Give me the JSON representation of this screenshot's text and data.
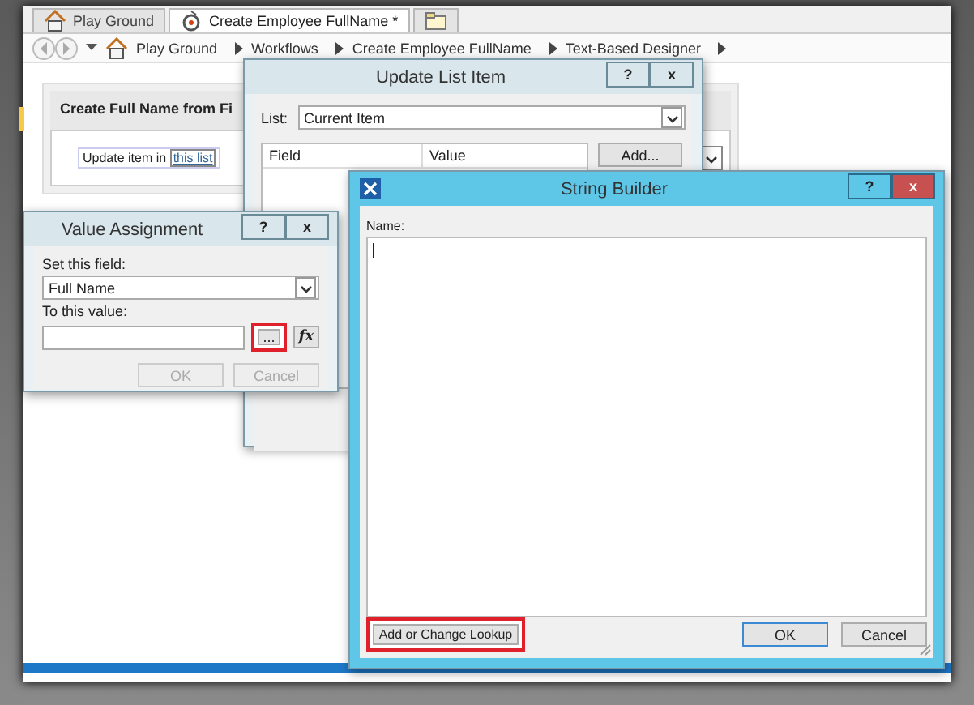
{
  "tabs": [
    {
      "label": "Play Ground",
      "selected": false
    },
    {
      "label": "Create Employee FullName *",
      "selected": true
    }
  ],
  "breadcrumb": [
    "Play Ground",
    "Workflows",
    "Create Employee FullName",
    "Text-Based Designer"
  ],
  "step": {
    "title": "Create Full Name from Fi",
    "action_text": "Update item in",
    "link": "this list"
  },
  "update_list_item": {
    "title": "Update List Item",
    "help": "?",
    "close": "x",
    "list_label": "List:",
    "list_value": "Current Item",
    "columns": [
      "Field",
      "Value"
    ],
    "add_button": "Add..."
  },
  "value_assignment": {
    "title": "Value Assignment",
    "help": "?",
    "close": "x",
    "field_label": "Set this field:",
    "field_value": "Full Name",
    "value_label": "To this value:",
    "buttons": [
      {
        "label": "...",
        "kind": "browse",
        "highlighted": true
      },
      {
        "label": "fx",
        "kind": "formula",
        "highlighted": false
      }
    ],
    "actions": [
      {
        "label": "OK",
        "disabled": true
      },
      {
        "label": "Cancel",
        "disabled": true
      }
    ]
  },
  "string_builder": {
    "title": "String Builder",
    "help": "?",
    "close": "x",
    "name_label": "Name:",
    "lookup_button": {
      "label": "Add or Change Lookup",
      "highlighted": true
    },
    "actions": [
      {
        "label": "OK",
        "default": true
      },
      {
        "label": "Cancel",
        "default": false
      }
    ]
  }
}
